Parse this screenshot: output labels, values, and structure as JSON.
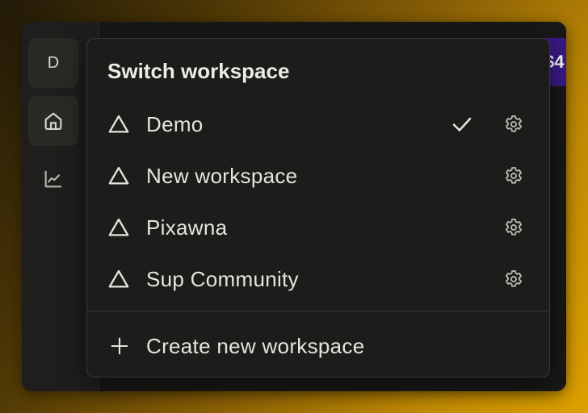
{
  "rail": {
    "avatar_letter": "D",
    "items": [
      {
        "icon": "home-icon"
      },
      {
        "icon": "chart-icon"
      }
    ]
  },
  "background_peek": {
    "purple_text": "$4"
  },
  "dropdown": {
    "title": "Switch workspace",
    "workspaces": [
      {
        "name": "Demo",
        "selected": true,
        "icon": "triangle-icon"
      },
      {
        "name": "New workspace",
        "selected": false,
        "icon": "triangle-icon"
      },
      {
        "name": "Pixawna",
        "selected": false,
        "icon": "triangle-icon"
      },
      {
        "name": "Sup Community",
        "selected": false,
        "icon": "triangle-icon"
      }
    ],
    "create_label": "Create new workspace"
  },
  "colors": {
    "accent_purple": "#3a1a86",
    "panel": "#1d1c1a",
    "text": "#e6e4de"
  }
}
